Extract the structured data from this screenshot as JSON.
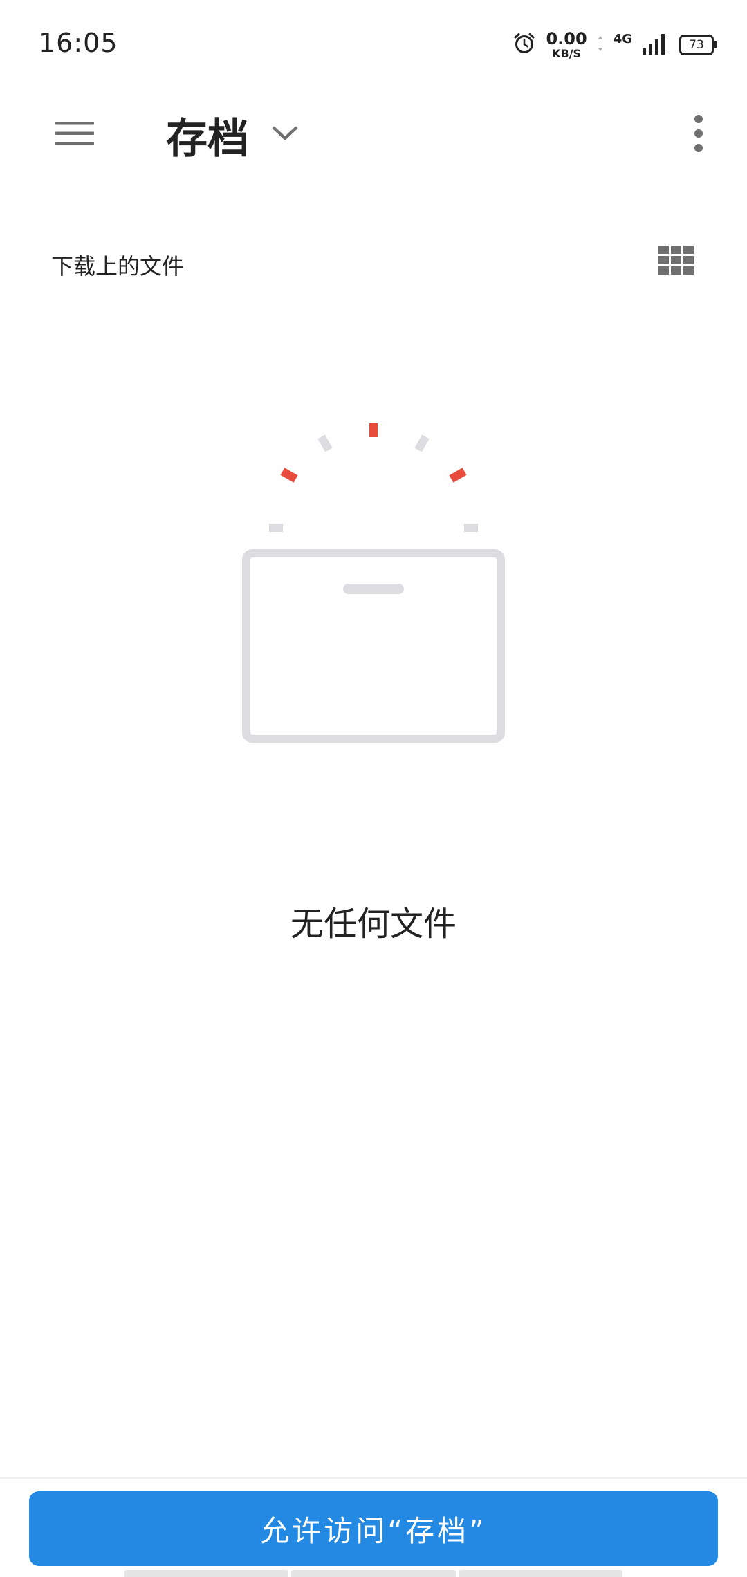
{
  "status_bar": {
    "time": "16:05",
    "net_speed_value": "0.00",
    "net_speed_unit": "KB/S",
    "network_type": "4G",
    "battery_level": "73",
    "icons": [
      "alarm-icon",
      "data-arrows-icon",
      "signal-icon",
      "battery-icon"
    ]
  },
  "app_bar": {
    "title": "存档",
    "icons": [
      "hamburger-menu-icon",
      "chevron-down-icon",
      "more-vert-icon"
    ]
  },
  "sub_header": {
    "title": "下载上的文件",
    "icon": "grid-view-icon"
  },
  "empty_state": {
    "icon": "empty-archive-box-illustration",
    "message": "无任何文件"
  },
  "bottom": {
    "allow_button_label": "允许访问“存档”"
  },
  "colors": {
    "accent_blue": "#2389e3",
    "illustration_red": "#e84c3d",
    "illustration_gray": "#dddde1",
    "icon_gray": "#6f6f6f"
  }
}
